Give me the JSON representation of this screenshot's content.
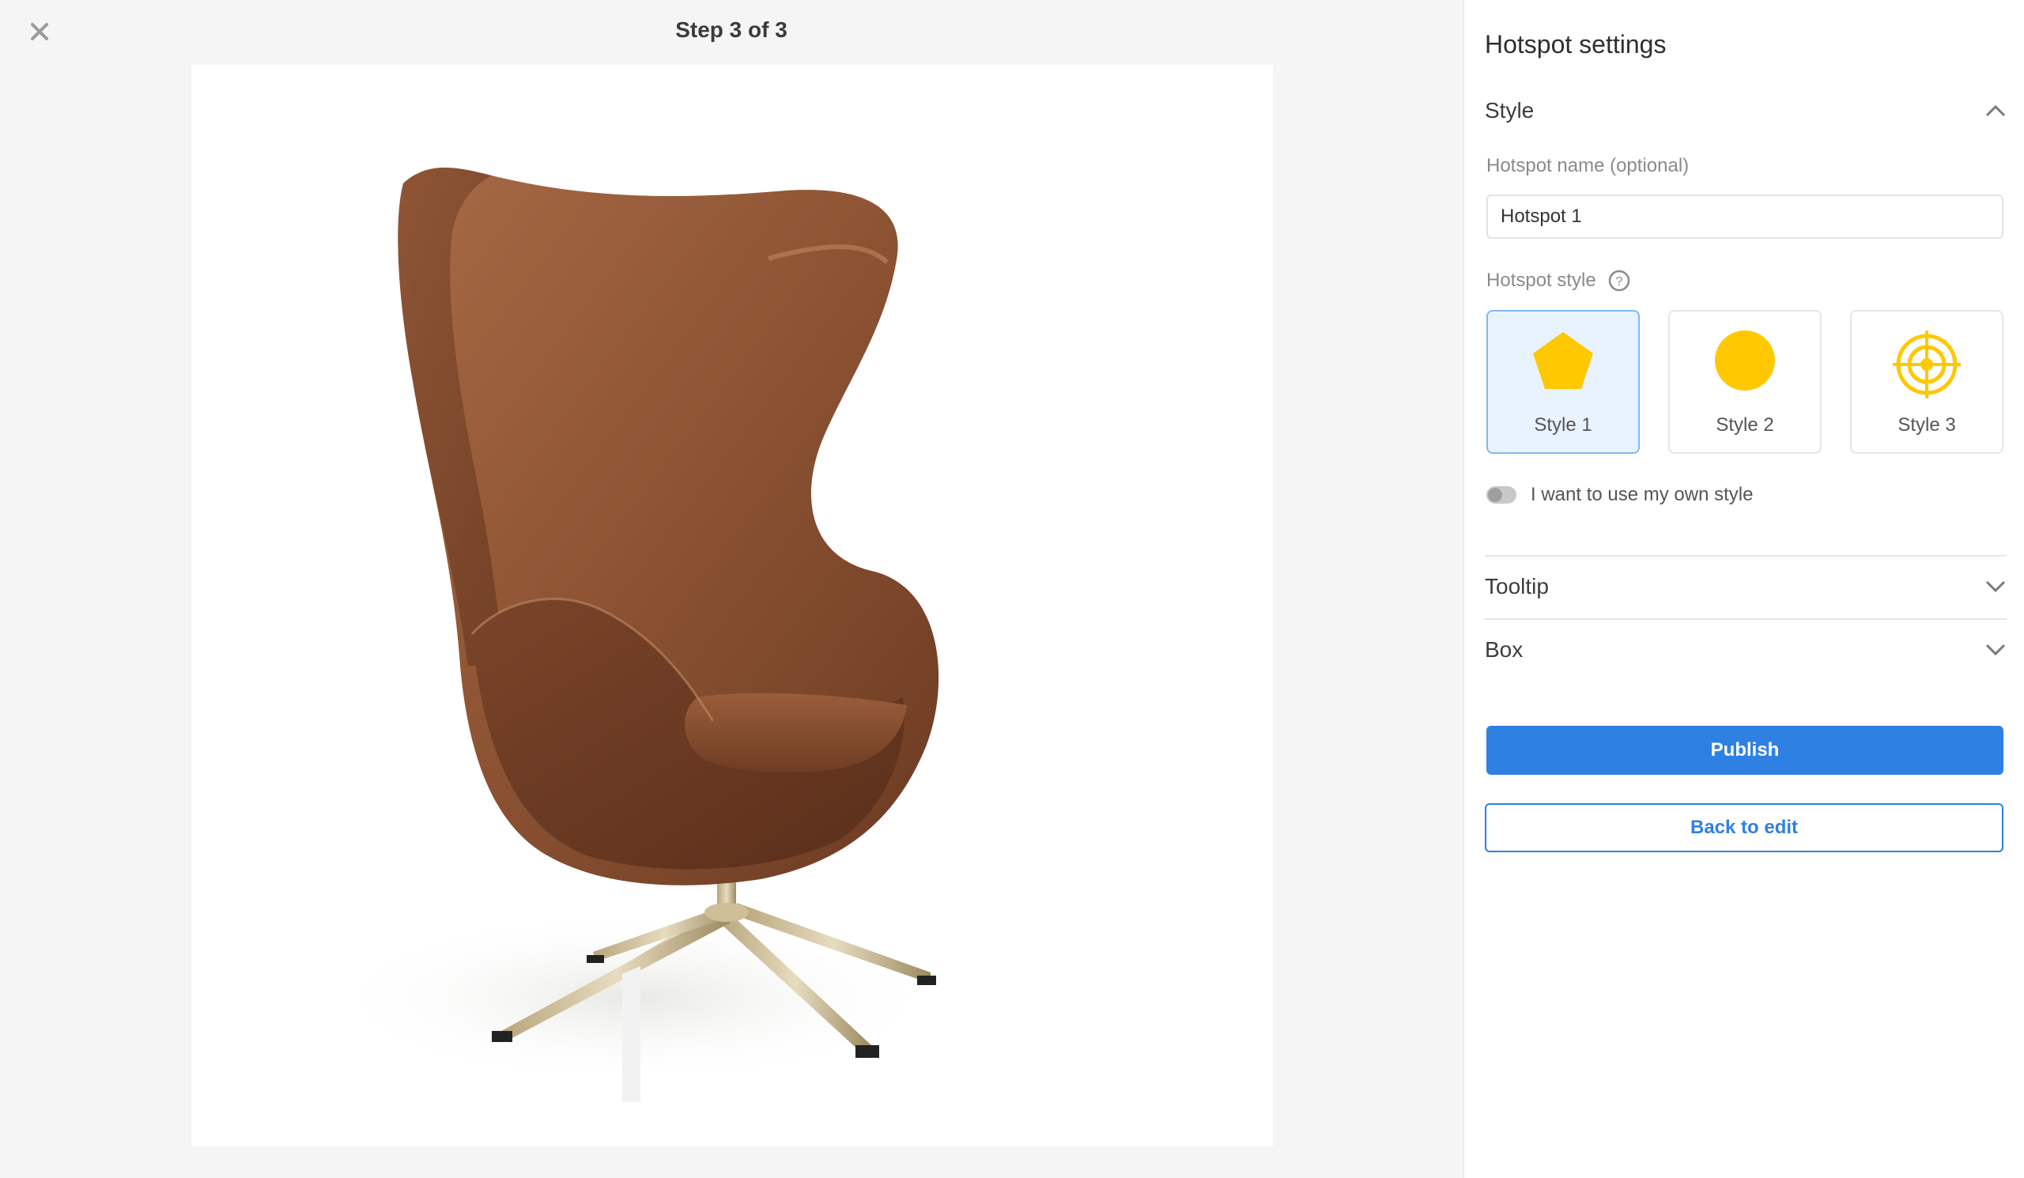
{
  "header": {
    "step_title": "Step 3 of 3",
    "close_icon": "close-icon"
  },
  "canvas": {
    "image_subject": "brown-leather-egg-chair"
  },
  "panel": {
    "title": "Hotspot settings",
    "style_section": {
      "label": "Style",
      "expanded": true,
      "name_label": "Hotspot name (optional)",
      "name_value": "Hotspot 1",
      "style_label": "Hotspot style",
      "help_icon": "help-circle-icon",
      "options": [
        {
          "label": "Style 1",
          "icon": "pentagon-icon",
          "selected": true
        },
        {
          "label": "Style 2",
          "icon": "circle-icon",
          "selected": false
        },
        {
          "label": "Style 3",
          "icon": "target-icon",
          "selected": false
        }
      ],
      "own_style_label": "I want to use my own style",
      "own_style_enabled": false
    },
    "tooltip_section": {
      "label": "Tooltip",
      "expanded": false
    },
    "box_section": {
      "label": "Box",
      "expanded": false
    },
    "publish_label": "Publish",
    "back_label": "Back to edit"
  },
  "colors": {
    "accent": "#2f80e3",
    "hotspot_yellow": "#ffc800",
    "selected_bg": "#e9f3fd"
  }
}
